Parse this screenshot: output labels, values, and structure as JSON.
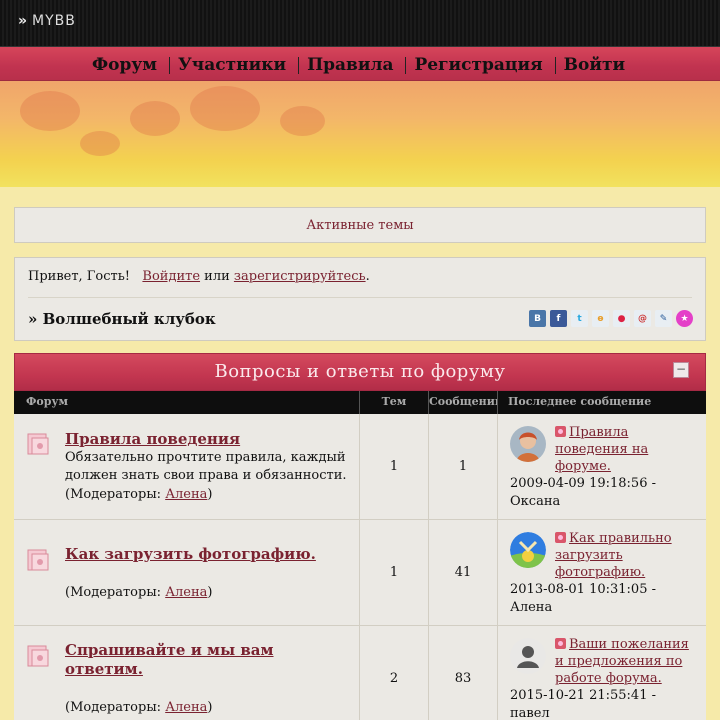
{
  "logo": {
    "text": "MYBB"
  },
  "nav": {
    "items": [
      {
        "label": "Форум"
      },
      {
        "label": "Участники"
      },
      {
        "label": "Правила"
      },
      {
        "label": "Регистрация"
      },
      {
        "label": "Войти"
      }
    ]
  },
  "active_topics": {
    "label": "Активные темы"
  },
  "welcome": {
    "greeting": "Привет, Гость!",
    "login_link": "Войдите",
    "or": "или",
    "register_link": "зарегистрируйтесь",
    "period": ".",
    "club_title": "» Волшебный клубок",
    "share_icons": [
      "vkontakte-icon",
      "facebook-icon",
      "twitter-icon",
      "odnoklassniki-icon",
      "moi-mir-icon",
      "mail-icon",
      "livejournal-icon",
      "star-icon"
    ]
  },
  "category": {
    "title": "Вопросы и ответы по форуму",
    "columns": {
      "forum": "Форум",
      "topics": "Тем",
      "posts": "Сообщений",
      "last": "Последнее сообщение"
    }
  },
  "forums": [
    {
      "title": "Правила поведения",
      "description": "Обязательно прочтите правила, каждый должен знать свои права и обязанности.",
      "moderators_label": "(Модераторы: ",
      "moderator": "Алена",
      "moderators_close": ")",
      "topics": "1",
      "posts": "1",
      "last_title": "Правила поведения на форуме.",
      "last_date": "2009-04-09 19:18:56 -",
      "last_author": "Оксана"
    },
    {
      "title": "Как загрузить фотографию.",
      "description": "",
      "moderators_label": "(Модераторы: ",
      "moderator": "Алена",
      "moderators_close": ")",
      "topics": "1",
      "posts": "41",
      "last_title": "Как правильно загрузить фотографию.",
      "last_date": "2013-08-01 10:31:05 -",
      "last_author": "Алена"
    },
    {
      "title": "Спрашивайте и мы вам ответим.",
      "description": "",
      "moderators_label": "(Модераторы: ",
      "moderator": "Алена",
      "moderators_close": ")",
      "topics": "2",
      "posts": "83",
      "last_title": "Ваши пожелания и предложения по работе форума.",
      "last_date": "2015-10-21 21:55:41 -",
      "last_author": "павел"
    }
  ]
}
